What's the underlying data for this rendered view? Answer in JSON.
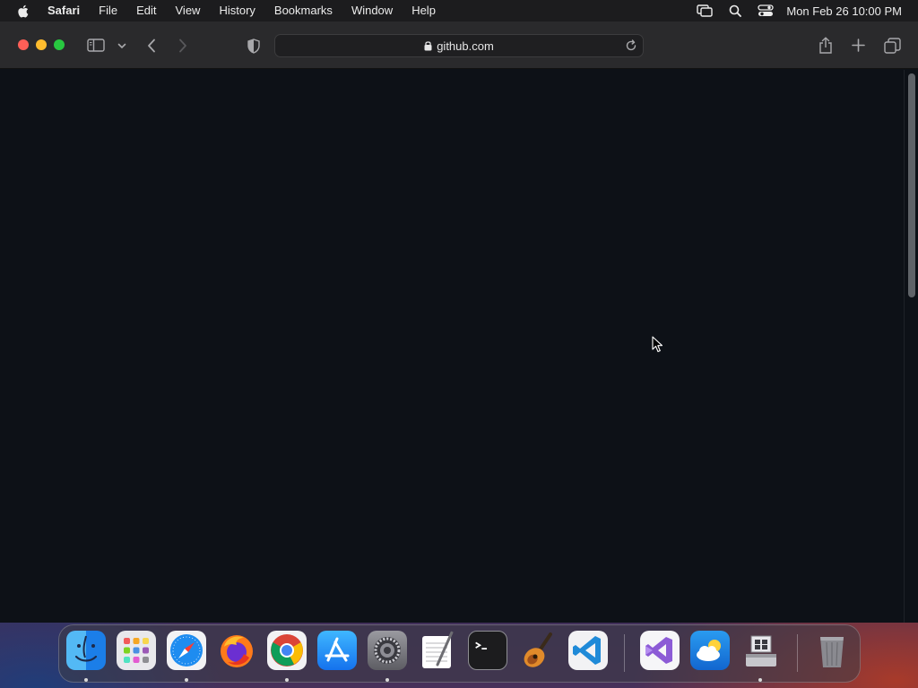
{
  "menubar": {
    "app_name": "Safari",
    "items": [
      "File",
      "Edit",
      "View",
      "History",
      "Bookmarks",
      "Window",
      "Help"
    ],
    "clock": "Mon Feb 26  10:00 PM",
    "status_icons": [
      "screen-mirroring-icon",
      "spotlight-search-icon",
      "control-center-icon"
    ]
  },
  "browser": {
    "url": "github.com",
    "toolbar_icons": [
      "sidebar-icon",
      "chevron-down-icon",
      "back-icon",
      "forward-icon",
      "privacy-shield-icon",
      "share-icon",
      "new-tab-icon",
      "tab-overview-icon"
    ]
  },
  "dock": {
    "apps": [
      {
        "name": "Finder",
        "running": true
      },
      {
        "name": "Launchpad",
        "running": false
      },
      {
        "name": "Safari",
        "running": true
      },
      {
        "name": "Firefox",
        "running": false
      },
      {
        "name": "Google Chrome",
        "running": true
      },
      {
        "name": "App Store",
        "running": false
      },
      {
        "name": "System Settings",
        "running": true
      },
      {
        "name": "TextEdit",
        "running": false
      },
      {
        "name": "Terminal",
        "running": false
      },
      {
        "name": "GarageBand",
        "running": false
      },
      {
        "name": "Visual Studio Code",
        "running": false
      },
      {
        "name": "Visual Studio",
        "running": false
      },
      {
        "name": "Weather",
        "running": false
      },
      {
        "name": "Boot Camp Assistant",
        "running": true
      },
      {
        "name": "Trash",
        "running": false
      }
    ]
  },
  "colors": {
    "page_background": "#0d1117",
    "menubar": "#1c1c1e",
    "toolbar": "#2a2a2c",
    "traffic_close": "#ff5f57",
    "traffic_minimize": "#febc2e",
    "traffic_zoom": "#28c840"
  }
}
